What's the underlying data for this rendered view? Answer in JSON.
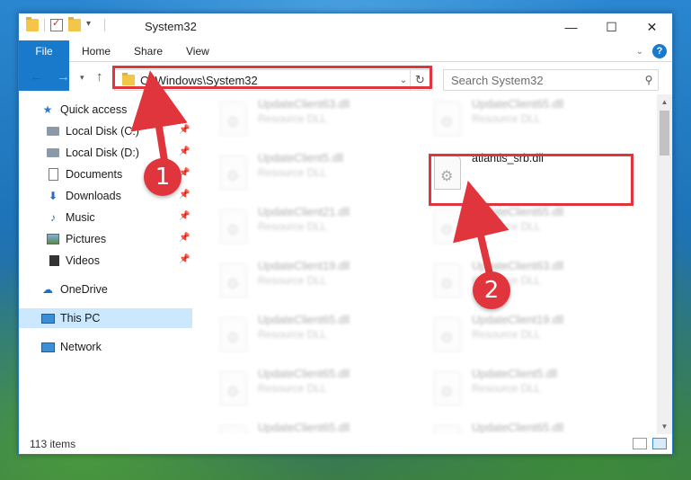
{
  "window": {
    "title": "System32",
    "controls": {
      "minimize": "—",
      "maximize": "☐",
      "close": "✕"
    }
  },
  "ribbon": {
    "tabs": [
      "File",
      "Home",
      "Share",
      "View"
    ],
    "expand_icon": "chevron-down-icon",
    "help": "?"
  },
  "navigation": {
    "address": "C:\\Windows\\System32",
    "search_placeholder": "Search System32"
  },
  "sidebar": {
    "items": [
      {
        "label": "Quick access",
        "icon": "star-icon",
        "pinned": false
      },
      {
        "label": "Local Disk (C:)",
        "icon": "drive-icon",
        "pinned": true
      },
      {
        "label": "Local Disk (D:)",
        "icon": "drive-icon",
        "pinned": true
      },
      {
        "label": "Documents",
        "icon": "documents-icon",
        "pinned": true
      },
      {
        "label": "Downloads",
        "icon": "downloads-icon",
        "pinned": true
      },
      {
        "label": "Music",
        "icon": "music-icon",
        "pinned": true
      },
      {
        "label": "Pictures",
        "icon": "pictures-icon",
        "pinned": true
      },
      {
        "label": "Videos",
        "icon": "videos-icon",
        "pinned": true
      },
      {
        "label": "OneDrive",
        "icon": "onedrive-icon",
        "pinned": false
      },
      {
        "label": "This PC",
        "icon": "this-pc-icon",
        "pinned": false,
        "selected": true
      },
      {
        "label": "Network",
        "icon": "network-icon",
        "pinned": false
      }
    ]
  },
  "files": [
    {
      "name": "UpdateClient63.dll",
      "type": "Resource DLL",
      "blurred": true
    },
    {
      "name": "UpdateClient65.dll",
      "type": "Resource DLL",
      "blurred": true
    },
    {
      "name": "UpdateClient5.dll",
      "type": "Resource DLL",
      "blurred": true
    },
    {
      "name": "atlantis_srb.dll",
      "type": "",
      "blurred": false,
      "highlighted": true
    },
    {
      "name": "UpdateClient21.dll",
      "type": "Resource DLL",
      "blurred": true
    },
    {
      "name": "UpdateClient65.dll",
      "type": "Resource DLL",
      "blurred": true
    },
    {
      "name": "UpdateClient19.dll",
      "type": "Resource DLL",
      "blurred": true
    },
    {
      "name": "UpdateClient63.dll",
      "type": "Resource DLL",
      "blurred": true
    },
    {
      "name": "UpdateClient65.dll",
      "type": "Resource DLL",
      "blurred": true
    },
    {
      "name": "UpdateClient19.dll",
      "type": "Resource DLL",
      "blurred": true
    },
    {
      "name": "UpdateClient65.dll",
      "type": "Resource DLL",
      "blurred": true
    },
    {
      "name": "UpdateClient5.dll",
      "type": "Resource DLL",
      "blurred": true
    },
    {
      "name": "UpdateClient65.dll",
      "type": "Resource DLL",
      "blurred": true
    },
    {
      "name": "UpdateClient65.dll",
      "type": "Resource DLL",
      "blurred": true
    }
  ],
  "status": {
    "item_count": "113 items"
  },
  "annotations": [
    {
      "number": "1",
      "target": "address bar"
    },
    {
      "number": "2",
      "target": "atlantis_srb.dll"
    }
  ],
  "colors": {
    "accent": "#1979ca",
    "annotation": "#e0353c",
    "selected": "#cce8ff"
  }
}
